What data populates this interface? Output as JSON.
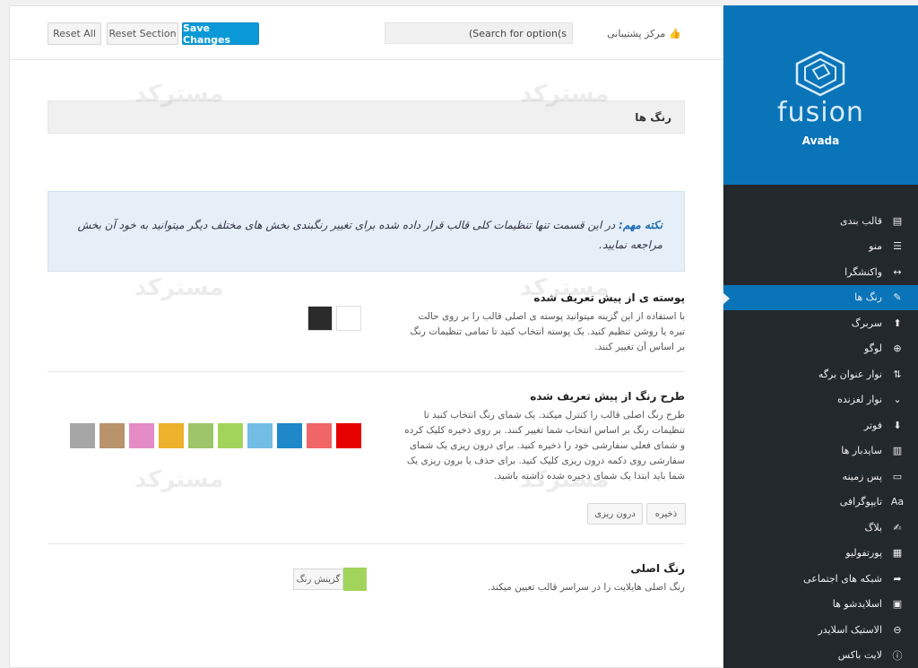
{
  "topbar": {
    "reset_all": "Reset All",
    "reset_section": "Reset Section",
    "save_changes": "Save Changes",
    "search_placeholder": "(Search for option(s",
    "support_label": "مرکز پشتیبانی"
  },
  "section": {
    "title": "رنگ ها"
  },
  "info": {
    "note_title": "نکته مهم:",
    "note_text": " در این قسمت تنها تنظیمات کلی قالب قرار داده شده برای تغییر رنگبندی بخش های مختلف دیگر میتوانید به خود آن بخش مراجعه نمایید."
  },
  "skin": {
    "title": "پوسته ی از پیش تعریف شده",
    "description": "با استفاده از این گزینه میتوانید پوسته ی اصلی قالب را بر روی حالت تیره یا روشن تنظیم کنید. یک پوسته انتخاب کنید تا تمامی تنظیمات رنگ بر اساس آن تغییر کنند.",
    "swatches": [
      "#2b2b2b",
      "#ffffff"
    ]
  },
  "scheme": {
    "title": "طرح رنگ از پیش تعریف شده",
    "description": "طرح رنگ اصلی قالب را کنترل میکند. یک شمای رنگ انتخاب کنید تا تنظیمات رنگ بر اساس انتخاب شما تغییر کنند. بر روی ذخیره کلیک کرده و شمای فعلی سفارشی خود را ذخیره کنید. برای درون ریزی یک شمای سفارشی روی دکمه درون ریزی کلیک کنید. برای حذف یا برون ریزی یک شما باید ابتدا یک شمای ذخیره شده داشته باشید.",
    "save_label": "ذخیره",
    "import_label": "درون ریزی",
    "swatches": [
      "#e60000",
      "#f06565",
      "#1e88c8",
      "#72bde6",
      "#a2d45b",
      "#9ec56a",
      "#edb12c",
      "#e58bc6",
      "#b9936c",
      "#a6a6a6"
    ]
  },
  "primary": {
    "title": "رنگ اصلی",
    "description": "رنگ اصلی هایلایت را در سراسر قالب تعیین میکند.",
    "picker_label": "گزینش رنگ",
    "color": "#a2d45b"
  },
  "brand": {
    "logo_text": "fusion",
    "name": "Avada"
  },
  "menu": [
    {
      "label": "قالب بندی",
      "icon": "▤",
      "name": "layout"
    },
    {
      "label": "منو",
      "icon": "☰",
      "name": "menu"
    },
    {
      "label": "واکنشگرا",
      "icon": "↔",
      "name": "responsive"
    },
    {
      "label": "رنگ ها",
      "icon": "✎",
      "name": "colors",
      "active": true
    },
    {
      "label": "سربرگ",
      "icon": "⬆",
      "name": "header"
    },
    {
      "label": "لوگو",
      "icon": "⊕",
      "name": "logo"
    },
    {
      "label": "نوار عنوان برگه",
      "icon": "⇅",
      "name": "page-title-bar"
    },
    {
      "label": "نوار لغزنده",
      "icon": "⌄",
      "name": "sliding-bar"
    },
    {
      "label": "فوتر",
      "icon": "⬇",
      "name": "footer"
    },
    {
      "label": "سایدبار ها",
      "icon": "▥",
      "name": "sidebars"
    },
    {
      "label": "پس زمینه",
      "icon": "▭",
      "name": "background"
    },
    {
      "label": "تایپوگرافی",
      "icon": "Aa",
      "name": "typography"
    },
    {
      "label": "بلاگ",
      "icon": "✍",
      "name": "blog"
    },
    {
      "label": "پورتفولیو",
      "icon": "▦",
      "name": "portfolio"
    },
    {
      "label": "شبکه های اجتماعی",
      "icon": "➦",
      "name": "social"
    },
    {
      "label": "اسلایدشو ها",
      "icon": "▣",
      "name": "slideshows"
    },
    {
      "label": "الاستیک اسلایدر",
      "icon": "⊖",
      "name": "elastic-slider"
    },
    {
      "label": "لایت باکس",
      "icon": "ⓘ",
      "name": "lightbox"
    }
  ]
}
